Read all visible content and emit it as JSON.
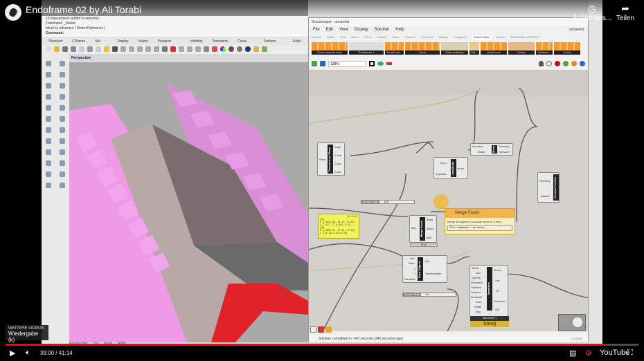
{
  "youtube": {
    "title": "Endoframe 02 by Ali Torabi",
    "watch_later": "Später ans...",
    "share": "Teilen",
    "more_videos": "WEITERE VIDEOS",
    "playback_tooltip": "Wiedergabe (k)",
    "time_current": "39:00",
    "time_total": "41:14",
    "progress": 0.946,
    "brand": "YouTube",
    "accent": "#ff0000"
  },
  "rhino": {
    "command_history": [
      "10 polysurfaces added to selection.",
      "Command: _Delete",
      "Mesh to reference ( Mode=Reference )"
    ],
    "command_prompt": "Command:",
    "tabs": [
      "Standard",
      "CPlanes",
      "Set View",
      "Display",
      "Select",
      "Viewport Layout",
      "Visibility",
      "Transform",
      "Curve Tools",
      "Surface Tools",
      "Solid Tools"
    ],
    "viewport_label": "Perspective",
    "viewport_tabs": [
      "Perspective",
      "Top",
      "Front",
      "Right"
    ]
  },
  "grasshopper": {
    "title": "Grasshopper - unnamed",
    "menu": [
      "File",
      "Edit",
      "View",
      "Display",
      "Solution",
      "Help"
    ],
    "document": "unnamed",
    "tabs": [
      "Params",
      "Maths",
      "Sets",
      "Vector",
      "Curve",
      "Surface",
      "Mesh",
      "Intersect",
      "Transform",
      "Display",
      "Kangaroo2",
      "Endo-Frame",
      "Human",
      "INDIVIDUAL RETREAT"
    ],
    "active_tab": "Endo-Frame",
    "groups": [
      "Close selected tools",
      "Endoframe 1",
      "EndoFram...",
      "Joints",
      "Material library",
      "Mis...",
      "Mesh tools",
      "Nodes",
      "Optimize...",
      "Shells"
    ],
    "zoom": "128%",
    "components": {
      "deconstruct": {
        "name": "Deconstruct Plane",
        "in": [
          "Plane"
        ],
        "out": [
          "Origin",
          "X-Axis",
          "Y-Axis",
          "Z-Axis"
        ]
      },
      "amplitude": {
        "name": "Amplitude",
        "in": [
          "Vector",
          "Amplitude"
        ],
        "out": [
          "Vector"
        ]
      },
      "move": {
        "name": "Move",
        "in": [
          "Geometry",
          "Motion"
        ],
        "out": [
          "Geometry",
          "Transform"
        ]
      },
      "preview": {
        "name": "Custom Preview",
        "in": [
          "Geometry",
          "Material"
        ]
      },
      "merge": {
        "name": "Merge Faces",
        "in": [
          "Brep"
        ],
        "out": [
          "Breps",
          "Before",
          "After"
        ],
        "footer": "Brep"
      },
      "pack": {
        "name": "Pack Objects",
        "in": [
          "Geo",
          "Plane",
          "X",
          "Y",
          "Orientation"
        ],
        "out": [
          "Geo",
          "Transformation"
        ]
      },
      "opennest": {
        "name": "OpenNest",
        "in": [
          "Sheets",
          "Geo",
          "Spacing",
          "Placement",
          "Tolerance",
          "Iterations",
          "Iterations2",
          "Seed",
          "Rotate",
          "Algo"
        ],
        "out": [
          "Sheets",
          "Geo",
          "ID",
          "Transform",
          "IDS"
        ],
        "footer": "Nest Sheet 1",
        "status": "String"
      }
    },
    "slider_amplitude": {
      "label": "Number Slider",
      "value": "18.6"
    },
    "slider_pack": {
      "label": "Number Slider",
      "value": "0.0"
    },
    "panel_points": {
      "header": "{1;0;0}",
      "lines": [
        "{0}",
        "0 {-283.16,-73.11,-0.29} 1 {-12,-77,0.49} 1.44",
        "{0}",
        "0 {-269.07,-73.41,-0.29} 2 {-6.43,1.02,0.29}"
      ]
    },
    "panel_meshes": {
      "header": "{Multiload}",
      "lines": [
        "1 Closed Mesh"
      ],
      "footer": "{Multiload}"
    },
    "tooltip": {
      "title": "Merge Faces",
      "description": "Merge all adjacent co-planar faces in a brep",
      "remark": "This component ran twice."
    },
    "status": "Solution completed in ~4.6 seconds (240 seconds ago)",
    "version": "1.0.0007"
  }
}
